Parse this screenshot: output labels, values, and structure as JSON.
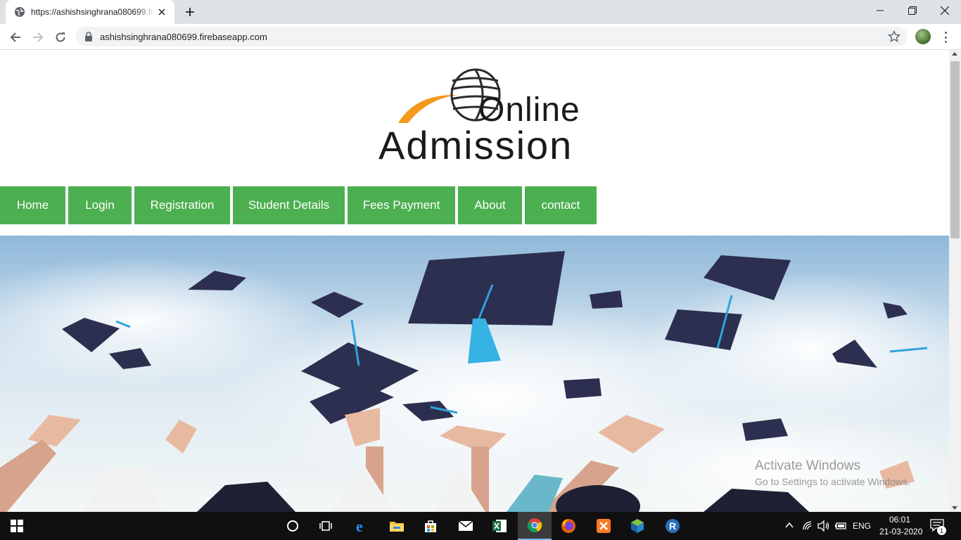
{
  "browser": {
    "tab_title": "https://ashishsinghrana080699.firebaseapp.com",
    "url": "ashishsinghrana080699.firebaseapp.com"
  },
  "logo": {
    "line1": "Online",
    "line2": "Admission"
  },
  "nav": {
    "items": [
      {
        "label": "Home"
      },
      {
        "label": "Login"
      },
      {
        "label": "Registration"
      },
      {
        "label": "Student Details"
      },
      {
        "label": "Fees Payment"
      },
      {
        "label": "About"
      },
      {
        "label": "contact"
      }
    ],
    "color": "#4caf50"
  },
  "watermark": {
    "title": "Activate Windows",
    "subtitle": "Go to Settings to activate Windows."
  },
  "taskbar": {
    "language": "ENG",
    "time": "06:01",
    "date": "21-03-2020",
    "notification_count": "1",
    "pinned_icons": [
      "windows-start-icon",
      "cortana-icon",
      "task-view-icon",
      "edge-icon",
      "file-explorer-icon",
      "store-icon",
      "mail-icon",
      "excel-icon",
      "chrome-icon",
      "firefox-icon",
      "xampp-icon",
      "virtualbox-icon",
      "r-icon"
    ]
  }
}
